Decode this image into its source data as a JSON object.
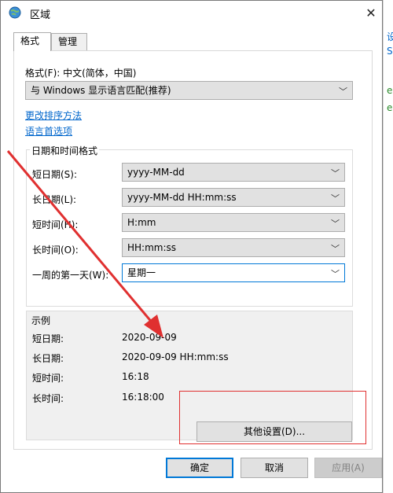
{
  "window": {
    "title": "区域"
  },
  "tabs": [
    {
      "label": "格式"
    },
    {
      "label": "管理"
    }
  ],
  "format": {
    "label": "格式(F): 中文(简体，中国)",
    "select_value": "与 Windows 显示语言匹配(推荐)",
    "link_sort": "更改排序方法",
    "link_lang": "语言首选项"
  },
  "datetime": {
    "group_title": "日期和时间格式",
    "rows": [
      {
        "label": "短日期(S):",
        "value": "yyyy-MM-dd"
      },
      {
        "label": "长日期(L):",
        "value": "yyyy-MM-dd HH:mm:ss"
      },
      {
        "label": "短时间(H):",
        "value": "H:mm"
      },
      {
        "label": "长时间(O):",
        "value": "HH:mm:ss"
      },
      {
        "label": "一周的第一天(W):",
        "value": "星期一"
      }
    ]
  },
  "examples": {
    "group_title": "示例",
    "rows": [
      {
        "label": "短日期:",
        "value": "2020-09-09"
      },
      {
        "label": "长日期:",
        "value": "2020-09-09 HH:mm:ss"
      },
      {
        "label": "短时间:",
        "value": "16:18"
      },
      {
        "label": "长时间:",
        "value": "16:18:00"
      }
    ]
  },
  "buttons": {
    "other_settings": "其他设置(D)...",
    "ok": "确定",
    "cancel": "取消",
    "apply": "应用(A)"
  },
  "background_window": {
    "chars": [
      "设",
      "S",
      "e",
      "e"
    ]
  },
  "colors": {
    "accent": "#0078d7",
    "link": "#0066cc",
    "annotation": "#e03030"
  }
}
